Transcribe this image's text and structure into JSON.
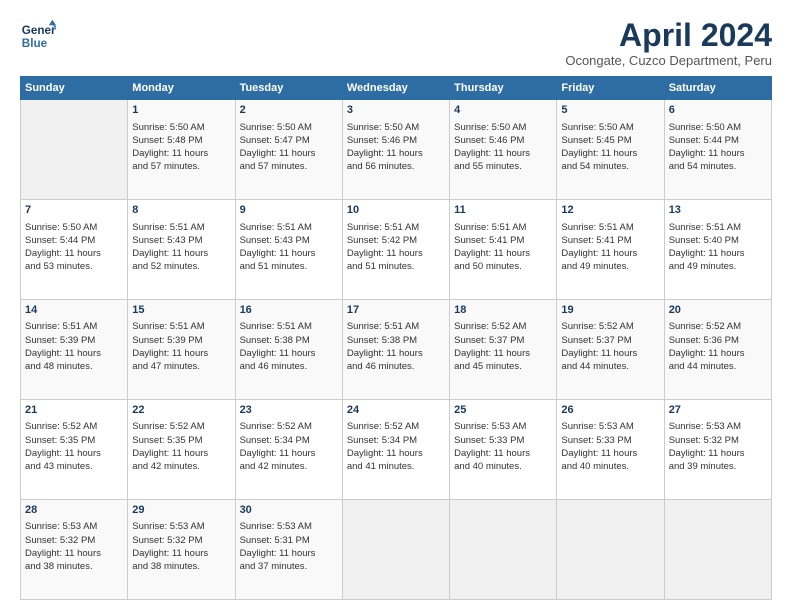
{
  "header": {
    "logo_line1": "General",
    "logo_line2": "Blue",
    "month_title": "April 2024",
    "location": "Ocongate, Cuzco Department, Peru"
  },
  "days_of_week": [
    "Sunday",
    "Monday",
    "Tuesday",
    "Wednesday",
    "Thursday",
    "Friday",
    "Saturday"
  ],
  "weeks": [
    [
      {
        "day": "",
        "info": ""
      },
      {
        "day": "1",
        "info": "Sunrise: 5:50 AM\nSunset: 5:48 PM\nDaylight: 11 hours\nand 57 minutes."
      },
      {
        "day": "2",
        "info": "Sunrise: 5:50 AM\nSunset: 5:47 PM\nDaylight: 11 hours\nand 57 minutes."
      },
      {
        "day": "3",
        "info": "Sunrise: 5:50 AM\nSunset: 5:46 PM\nDaylight: 11 hours\nand 56 minutes."
      },
      {
        "day": "4",
        "info": "Sunrise: 5:50 AM\nSunset: 5:46 PM\nDaylight: 11 hours\nand 55 minutes."
      },
      {
        "day": "5",
        "info": "Sunrise: 5:50 AM\nSunset: 5:45 PM\nDaylight: 11 hours\nand 54 minutes."
      },
      {
        "day": "6",
        "info": "Sunrise: 5:50 AM\nSunset: 5:44 PM\nDaylight: 11 hours\nand 54 minutes."
      }
    ],
    [
      {
        "day": "7",
        "info": "Sunrise: 5:50 AM\nSunset: 5:44 PM\nDaylight: 11 hours\nand 53 minutes."
      },
      {
        "day": "8",
        "info": "Sunrise: 5:51 AM\nSunset: 5:43 PM\nDaylight: 11 hours\nand 52 minutes."
      },
      {
        "day": "9",
        "info": "Sunrise: 5:51 AM\nSunset: 5:43 PM\nDaylight: 11 hours\nand 51 minutes."
      },
      {
        "day": "10",
        "info": "Sunrise: 5:51 AM\nSunset: 5:42 PM\nDaylight: 11 hours\nand 51 minutes."
      },
      {
        "day": "11",
        "info": "Sunrise: 5:51 AM\nSunset: 5:41 PM\nDaylight: 11 hours\nand 50 minutes."
      },
      {
        "day": "12",
        "info": "Sunrise: 5:51 AM\nSunset: 5:41 PM\nDaylight: 11 hours\nand 49 minutes."
      },
      {
        "day": "13",
        "info": "Sunrise: 5:51 AM\nSunset: 5:40 PM\nDaylight: 11 hours\nand 49 minutes."
      }
    ],
    [
      {
        "day": "14",
        "info": "Sunrise: 5:51 AM\nSunset: 5:39 PM\nDaylight: 11 hours\nand 48 minutes."
      },
      {
        "day": "15",
        "info": "Sunrise: 5:51 AM\nSunset: 5:39 PM\nDaylight: 11 hours\nand 47 minutes."
      },
      {
        "day": "16",
        "info": "Sunrise: 5:51 AM\nSunset: 5:38 PM\nDaylight: 11 hours\nand 46 minutes."
      },
      {
        "day": "17",
        "info": "Sunrise: 5:51 AM\nSunset: 5:38 PM\nDaylight: 11 hours\nand 46 minutes."
      },
      {
        "day": "18",
        "info": "Sunrise: 5:52 AM\nSunset: 5:37 PM\nDaylight: 11 hours\nand 45 minutes."
      },
      {
        "day": "19",
        "info": "Sunrise: 5:52 AM\nSunset: 5:37 PM\nDaylight: 11 hours\nand 44 minutes."
      },
      {
        "day": "20",
        "info": "Sunrise: 5:52 AM\nSunset: 5:36 PM\nDaylight: 11 hours\nand 44 minutes."
      }
    ],
    [
      {
        "day": "21",
        "info": "Sunrise: 5:52 AM\nSunset: 5:35 PM\nDaylight: 11 hours\nand 43 minutes."
      },
      {
        "day": "22",
        "info": "Sunrise: 5:52 AM\nSunset: 5:35 PM\nDaylight: 11 hours\nand 42 minutes."
      },
      {
        "day": "23",
        "info": "Sunrise: 5:52 AM\nSunset: 5:34 PM\nDaylight: 11 hours\nand 42 minutes."
      },
      {
        "day": "24",
        "info": "Sunrise: 5:52 AM\nSunset: 5:34 PM\nDaylight: 11 hours\nand 41 minutes."
      },
      {
        "day": "25",
        "info": "Sunrise: 5:53 AM\nSunset: 5:33 PM\nDaylight: 11 hours\nand 40 minutes."
      },
      {
        "day": "26",
        "info": "Sunrise: 5:53 AM\nSunset: 5:33 PM\nDaylight: 11 hours\nand 40 minutes."
      },
      {
        "day": "27",
        "info": "Sunrise: 5:53 AM\nSunset: 5:32 PM\nDaylight: 11 hours\nand 39 minutes."
      }
    ],
    [
      {
        "day": "28",
        "info": "Sunrise: 5:53 AM\nSunset: 5:32 PM\nDaylight: 11 hours\nand 38 minutes."
      },
      {
        "day": "29",
        "info": "Sunrise: 5:53 AM\nSunset: 5:32 PM\nDaylight: 11 hours\nand 38 minutes."
      },
      {
        "day": "30",
        "info": "Sunrise: 5:53 AM\nSunset: 5:31 PM\nDaylight: 11 hours\nand 37 minutes."
      },
      {
        "day": "",
        "info": ""
      },
      {
        "day": "",
        "info": ""
      },
      {
        "day": "",
        "info": ""
      },
      {
        "day": "",
        "info": ""
      }
    ]
  ]
}
